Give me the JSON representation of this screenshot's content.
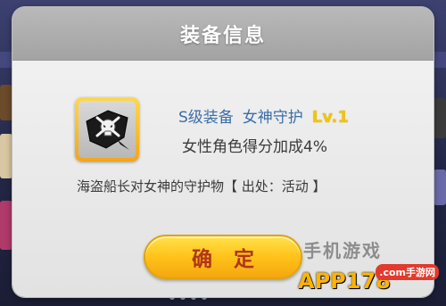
{
  "dialog": {
    "title": "装备信息",
    "item": {
      "icon": "pirate-skull-scarf-icon",
      "grade_label": "S级装备",
      "name": "女神守护",
      "level": "Lv.1",
      "effect": "女性角色得分加成4%",
      "description": "海盗船长对女神的守护物【 出处：活动 】"
    },
    "confirm_label": "确 定"
  },
  "watermark": {
    "faint_text": "手机游戏",
    "brand": "APP178",
    "badge": ".com手游网"
  },
  "colors": {
    "header": "#a9a9a9",
    "name_blue": "#3b6ea8",
    "level_yellow": "#f5c400",
    "button_yellow": "#ffc21a",
    "button_text": "#b0351a",
    "slot_gold": "#f2a51c"
  }
}
